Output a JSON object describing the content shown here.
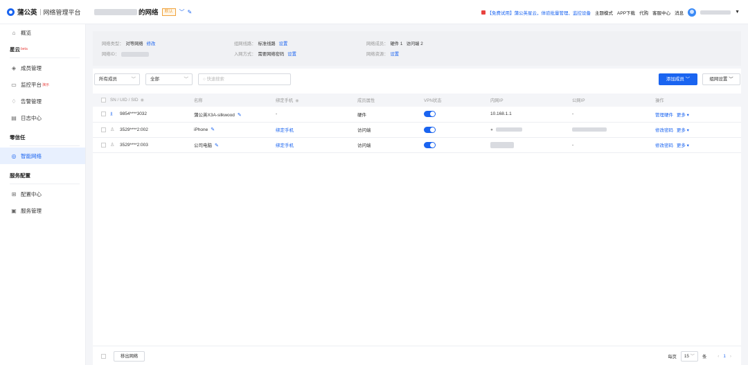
{
  "header": {
    "brand_name": "蒲公英",
    "brand_sub": "网络管理平台",
    "network_title": "的网络",
    "default_badge": "默认",
    "promo_text": "【免费试用】蒲公英星云，体验批量管理、监控设备",
    "links": [
      "主题模式",
      "APP下载",
      "代购",
      "客服中心",
      "消息"
    ]
  },
  "sidebar": {
    "overview": "概览",
    "group_xingyun": "星云",
    "beta": "beta",
    "members": "成员管理",
    "monitor": "监控平台",
    "demo": "演示",
    "alerts": "告警管理",
    "logs": "日志中心",
    "group_zero_trust": "零信任",
    "smart_network": "智能网络",
    "group_service": "服务配置",
    "config_center": "配置中心",
    "service_mgmt": "服务管理"
  },
  "info": {
    "net_type_label": "网络类型：",
    "net_type_value": "对等网络",
    "net_type_action": "修改",
    "net_id_label": "网络ID：",
    "line_label": "组网线路：",
    "line_value": "标准线路",
    "line_action": "设置",
    "join_label": "入网方式：",
    "join_value": "需要网络密码",
    "join_action": "设置",
    "members_label": "网络成员：",
    "members_value": "硬件 1   访问端 2",
    "resources_label": "网络资源：",
    "resources_action": "设置"
  },
  "filters": {
    "members_select": "所有成员",
    "scope_select": "全部",
    "search_placeholder": "快速搜索",
    "add_member": "添加成员",
    "network_settings": "组网设置"
  },
  "table": {
    "columns": [
      "SN / UID / SID",
      "名称",
      "绑定手机",
      "成员属性",
      "VPN状态",
      "内网IP",
      "公网IP",
      "操作"
    ],
    "rows": [
      {
        "id": "9854****3032",
        "name": "蒲公英X3A-silkwood",
        "phone": "-",
        "type": "硬件",
        "ip": "10.168.1.1",
        "public_ip": "-",
        "action1": "管理硬件",
        "action2": "更多"
      },
      {
        "id": "3529****2:002",
        "name": "iPhone",
        "phone": "绑定手机",
        "type": "访问端",
        "ip": "",
        "public_ip": "",
        "action1": "修改密码",
        "action2": "更多"
      },
      {
        "id": "3529****2:003",
        "name": "公司电脑",
        "phone": "绑定手机",
        "type": "访问端",
        "ip": "",
        "public_ip": "-",
        "action1": "修改密码",
        "action2": "更多"
      }
    ]
  },
  "footer": {
    "exit_button": "移出网络",
    "per_page_label": "每页",
    "per_page_value": "15",
    "per_page_unit": "条",
    "current_page": "1"
  }
}
